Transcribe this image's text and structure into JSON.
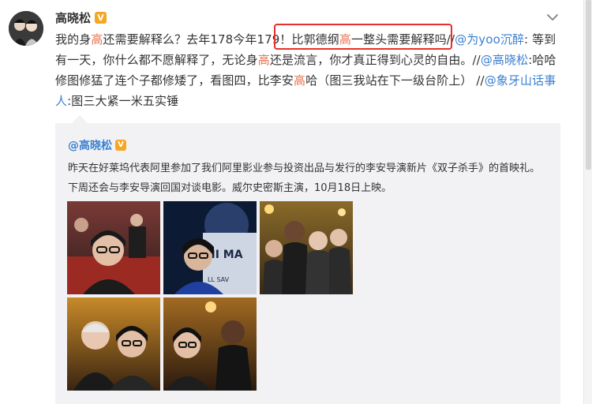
{
  "post": {
    "author": "高晓松",
    "verified_badge": "V",
    "text_segments": [
      {
        "t": "我的身",
        "style": "plain"
      },
      {
        "t": "高",
        "style": "hl"
      },
      {
        "t": "还需要解释么？去年178今年179！比郭德纲",
        "style": "plain"
      },
      {
        "t": "高",
        "style": "hl"
      },
      {
        "t": "一整头需要解释吗//",
        "style": "plain"
      },
      {
        "t": "@为yoo沉醉",
        "style": "link"
      },
      {
        "t": ": 等到有一天，你什么都不愿解释了，无论身",
        "style": "plain"
      },
      {
        "t": "高",
        "style": "hl"
      },
      {
        "t": "还是流言，你才真正得到心灵的自由。//",
        "style": "plain"
      },
      {
        "t": "@高晓松",
        "style": "link"
      },
      {
        "t": ":哈哈修图修猛了连个子都修矮了，看图四，比李安",
        "style": "plain"
      },
      {
        "t": "高",
        "style": "hl"
      },
      {
        "t": "哈（图三我站在下一级台阶上） //",
        "style": "plain"
      },
      {
        "t": "@象牙山话事人",
        "style": "link"
      },
      {
        "t": ":图三大紧一米五实锤",
        "style": "plain"
      }
    ]
  },
  "repost": {
    "author": "@高晓松",
    "verified_badge": "V",
    "text": "昨天在好莱坞代表阿里参加了我们阿里影业参与投资出品与发行的李安导演新片《双子杀手》的首映礼。下周还会与李安导演回国对谈电影。威尔史密斯主演，10月18日上映。",
    "photos": [
      {
        "name": "photo-1-red-carpet"
      },
      {
        "name": "photo-2-poster-selfie"
      },
      {
        "name": "photo-3-group"
      },
      {
        "name": "photo-4-with-ang-lee"
      },
      {
        "name": "photo-5-with-will-smith"
      }
    ]
  },
  "colors": {
    "highlight_text": "#eb7350",
    "link_text": "#3a7fd0",
    "annotation_box": "#e4312b",
    "verified_badge": "#f6a623",
    "repost_bg": "#f2f2f5"
  },
  "icons": {
    "more": "chevron-down-icon",
    "verified": "verified-v-icon"
  }
}
